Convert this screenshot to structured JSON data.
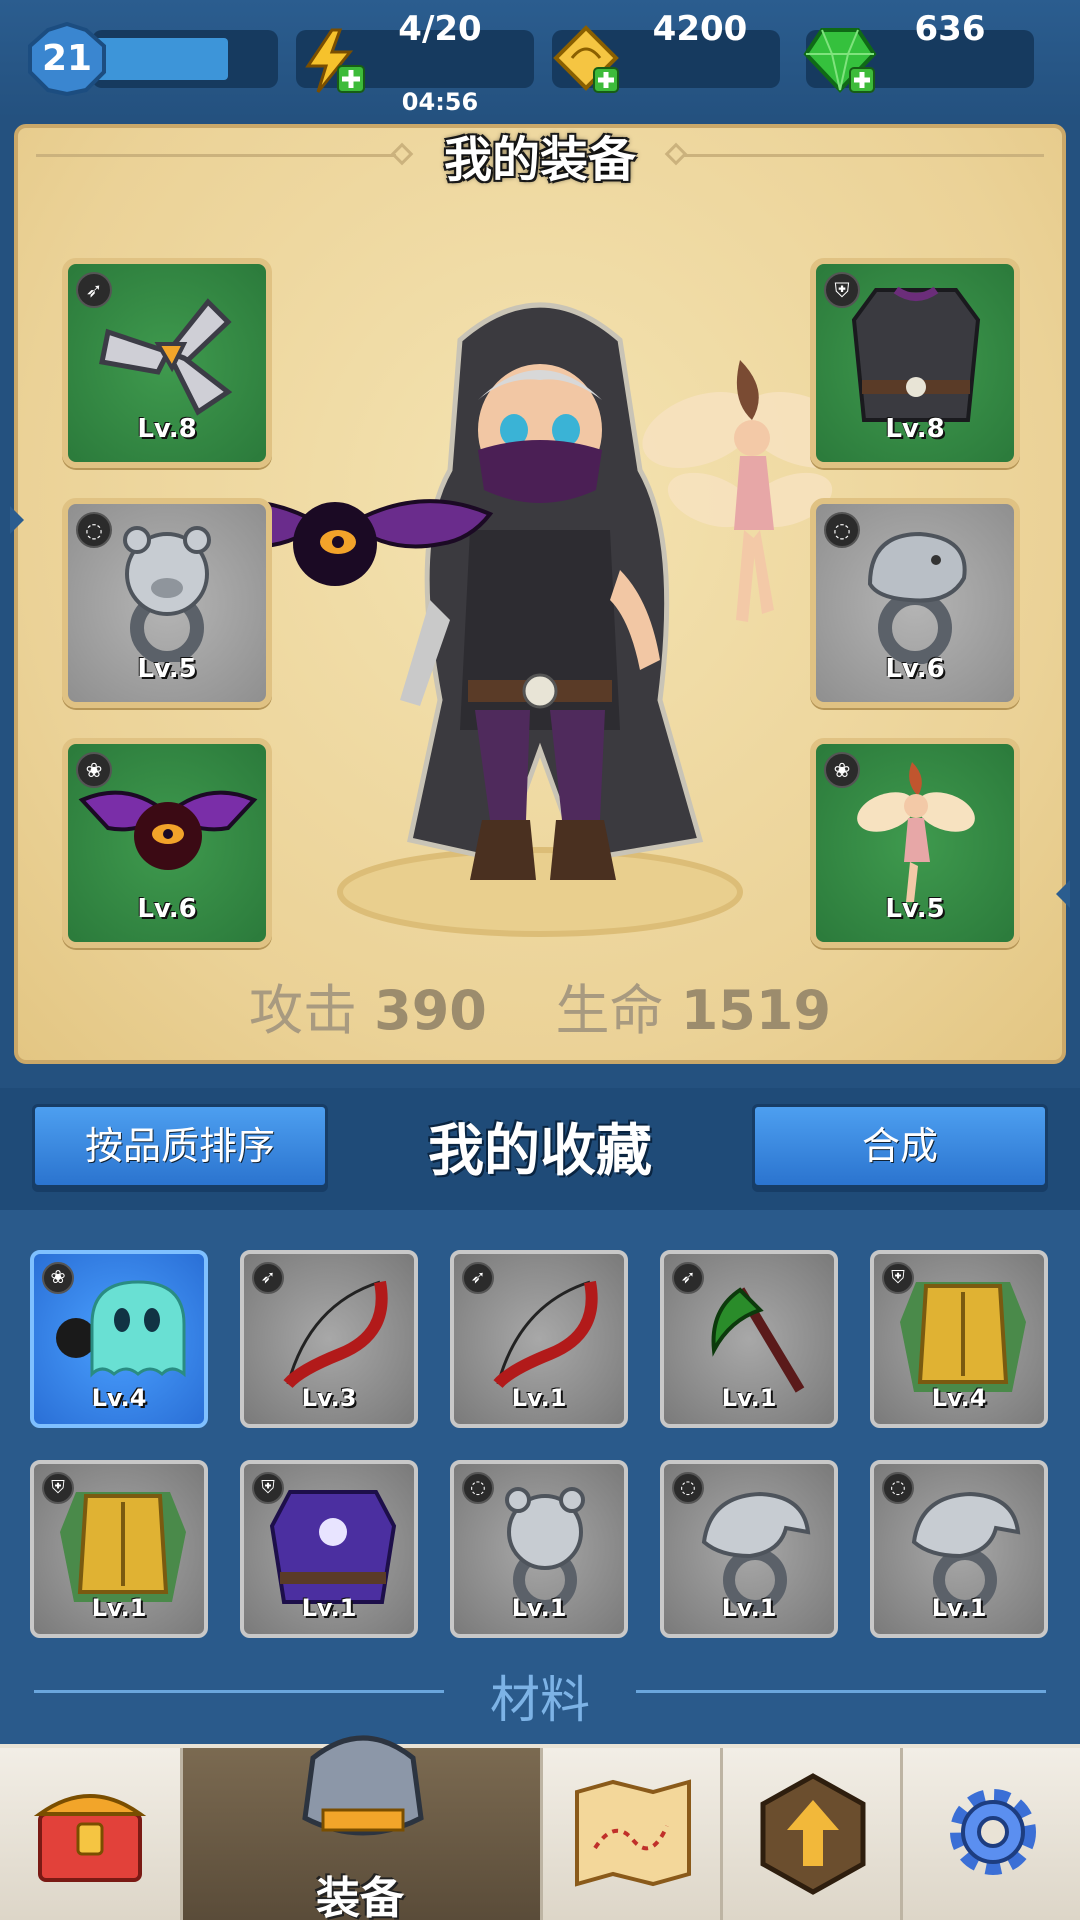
{
  "top_bar": {
    "level": "21",
    "energy": "4/20",
    "energy_timer": "04:56",
    "gold": "4200",
    "gems": "636"
  },
  "equipment": {
    "title": "我的装备",
    "slots_left": [
      {
        "level": "Lv.8",
        "category_icon": "bow-icon",
        "item_icon": "shuriken-icon",
        "rarity": "green"
      },
      {
        "level": "Lv.5",
        "category_icon": "ring-icon",
        "item_icon": "bear-ring-icon",
        "rarity": "gray"
      },
      {
        "level": "Lv.6",
        "category_icon": "paw-icon",
        "item_icon": "bat-pet-icon",
        "rarity": "green"
      }
    ],
    "slots_right": [
      {
        "level": "Lv.8",
        "category_icon": "armor-icon",
        "item_icon": "vest-icon",
        "rarity": "green"
      },
      {
        "level": "Lv.6",
        "category_icon": "ring-icon",
        "item_icon": "serpent-ring-icon",
        "rarity": "gray"
      },
      {
        "level": "Lv.5",
        "category_icon": "paw-icon",
        "item_icon": "fairy-pet-icon",
        "rarity": "green"
      }
    ],
    "attack_label": "攻击",
    "attack_value": "390",
    "hp_label": "生命",
    "hp_value": "1519"
  },
  "collection": {
    "sort_button": "按品质排序",
    "title": "我的收藏",
    "merge_button": "合成",
    "items": [
      {
        "level": "Lv.4",
        "category_icon": "paw-icon",
        "item_icon": "ghost-pet-icon",
        "selected": true
      },
      {
        "level": "Lv.3",
        "category_icon": "bow-icon",
        "item_icon": "red-bow-icon"
      },
      {
        "level": "Lv.1",
        "category_icon": "bow-icon",
        "item_icon": "red-bow-icon"
      },
      {
        "level": "Lv.1",
        "category_icon": "bow-icon",
        "item_icon": "scythe-icon"
      },
      {
        "level": "Lv.4",
        "category_icon": "armor-icon",
        "item_icon": "gold-armor-icon"
      },
      {
        "level": "Lv.1",
        "category_icon": "armor-icon",
        "item_icon": "gold-armor-icon"
      },
      {
        "level": "Lv.1",
        "category_icon": "armor-icon",
        "item_icon": "purple-vest-icon"
      },
      {
        "level": "Lv.1",
        "category_icon": "ring-icon",
        "item_icon": "bear-ring-icon"
      },
      {
        "level": "Lv.1",
        "category_icon": "ring-icon",
        "item_icon": "eagle-ring-icon"
      },
      {
        "level": "Lv.1",
        "category_icon": "ring-icon",
        "item_icon": "eagle-ring-icon"
      }
    ],
    "materials_title": "材料"
  },
  "bottom_nav": {
    "items": [
      {
        "icon": "treasure-chest-icon"
      },
      {
        "icon": "armor-helmet-icon",
        "label": "装备",
        "active": true
      },
      {
        "icon": "map-icon"
      },
      {
        "icon": "upgrade-arrow-icon"
      },
      {
        "icon": "settings-gear-icon"
      }
    ]
  },
  "colors": {
    "background": "#24517f",
    "panel": "#ebd297",
    "green_slot": "#2b7a3b",
    "gray_slot": "#8f8f8f",
    "button_blue": "#2b74cf"
  }
}
